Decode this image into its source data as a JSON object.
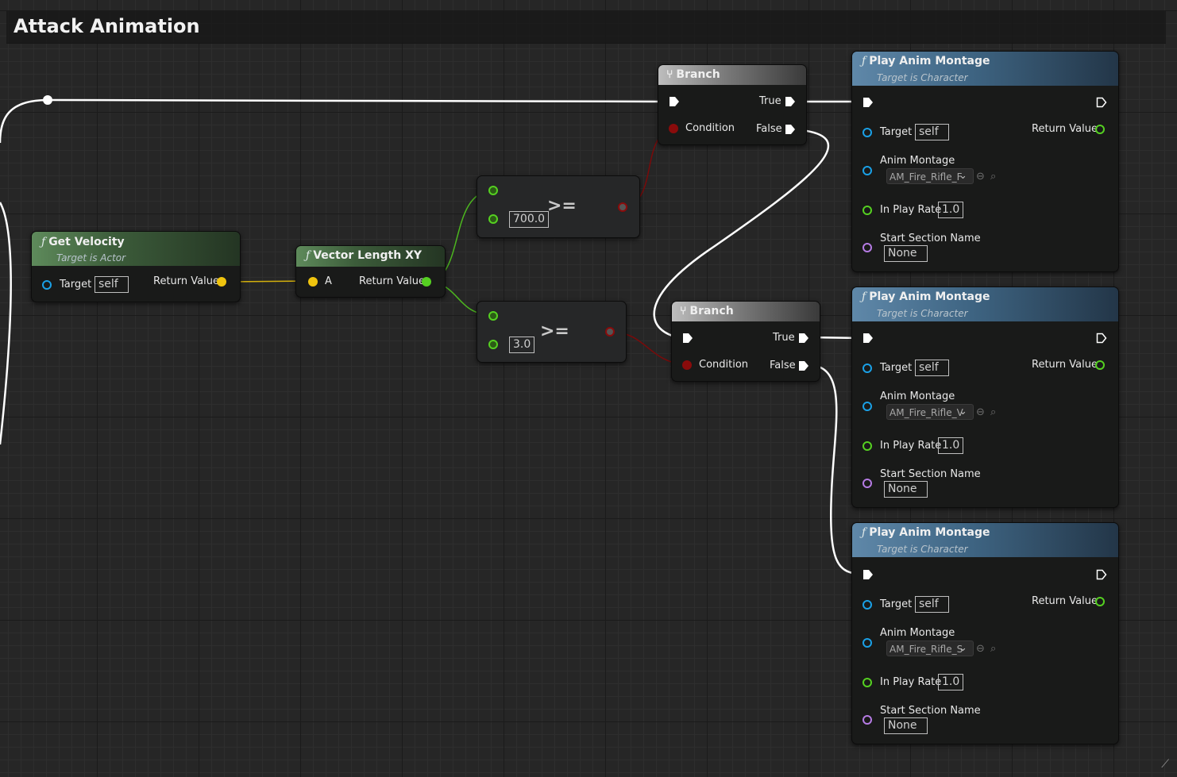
{
  "comment": {
    "title": "Attack Animation"
  },
  "colors": {
    "exec": "#ffffff",
    "object": "#1aa0e6",
    "vector": "#f0c40e",
    "float": "#55d021",
    "bool": "#8a0b0b",
    "name": "#b57be3"
  },
  "get_velocity": {
    "title": "Get Velocity",
    "subtitle": "Target is Actor",
    "target_label": "Target",
    "target_value": "self",
    "return_label": "Return Value"
  },
  "vector_length": {
    "title": "Vector Length XY",
    "a_label": "A",
    "return_label": "Return Value"
  },
  "compare1": {
    "op": ">=",
    "value": "700.0"
  },
  "compare2": {
    "op": ">=",
    "value": "3.0"
  },
  "branch1": {
    "title": "Branch",
    "true_label": "True",
    "false_label": "False",
    "condition_label": "Condition"
  },
  "branch2": {
    "title": "Branch",
    "true_label": "True",
    "false_label": "False",
    "condition_label": "Condition"
  },
  "montage1": {
    "title": "Play Anim Montage",
    "subtitle": "Target is Character",
    "target_label": "Target",
    "target_value": "self",
    "return_label": "Return Value",
    "anim_label": "Anim Montage",
    "anim_value": "AM_Fire_Rifle_F",
    "rate_label": "In Play Rate",
    "rate_value": "1.0",
    "section_label": "Start Section Name",
    "section_value": "None"
  },
  "montage2": {
    "title": "Play Anim Montage",
    "subtitle": "Target is Character",
    "target_label": "Target",
    "target_value": "self",
    "return_label": "Return Value",
    "anim_label": "Anim Montage",
    "anim_value": "AM_Fire_Rifle_V",
    "rate_label": "In Play Rate",
    "rate_value": "1.0",
    "section_label": "Start Section Name",
    "section_value": "None"
  },
  "montage3": {
    "title": "Play Anim Montage",
    "subtitle": "Target is Character",
    "target_label": "Target",
    "target_value": "self",
    "return_label": "Return Value",
    "anim_label": "Anim Montage",
    "anim_value": "AM_Fire_Rifle_S",
    "rate_label": "In Play Rate",
    "rate_value": "1.0",
    "section_label": "Start Section Name",
    "section_value": "None"
  }
}
